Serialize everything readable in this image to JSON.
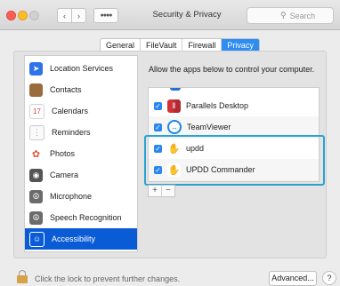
{
  "window": {
    "title": "Security & Privacy",
    "search_placeholder": "Search"
  },
  "tabs": [
    {
      "label": "General"
    },
    {
      "label": "FileVault"
    },
    {
      "label": "Firewall"
    },
    {
      "label": "Privacy",
      "selected": true
    }
  ],
  "sidebar": {
    "items": [
      {
        "label": "Location Services",
        "icon": "location-arrow-icon"
      },
      {
        "label": "Contacts",
        "icon": "contacts-book-icon"
      },
      {
        "label": "Calendars",
        "icon": "calendar-icon",
        "icon_text": "17"
      },
      {
        "label": "Reminders",
        "icon": "reminders-list-icon"
      },
      {
        "label": "Photos",
        "icon": "photos-flower-icon"
      },
      {
        "label": "Camera",
        "icon": "camera-icon"
      },
      {
        "label": "Microphone",
        "icon": "microphone-icon"
      },
      {
        "label": "Speech Recognition",
        "icon": "speech-waveform-icon"
      },
      {
        "label": "Accessibility",
        "icon": "accessibility-person-icon",
        "selected": true
      }
    ]
  },
  "main": {
    "prompt": "Allow the apps below to control your computer.",
    "apps": [
      {
        "name": "Parallels Desktop",
        "checked": true,
        "icon": "parallels-icon"
      },
      {
        "name": "TeamViewer",
        "checked": true,
        "icon": "teamviewer-icon"
      },
      {
        "name": "updd",
        "checked": true,
        "icon": "updd-hand-icon"
      },
      {
        "name": "UPDD Commander",
        "checked": true,
        "icon": "updd-commander-icon"
      }
    ],
    "add_label": "+",
    "remove_label": "−",
    "highlight_color": "#2aa3d1"
  },
  "footer": {
    "lock_text": "Click the lock to prevent further changes.",
    "advanced_label": "Advanced...",
    "help_label": "?"
  },
  "colors": {
    "accent": "#2f8cf3",
    "selection": "#0a5bd6"
  }
}
